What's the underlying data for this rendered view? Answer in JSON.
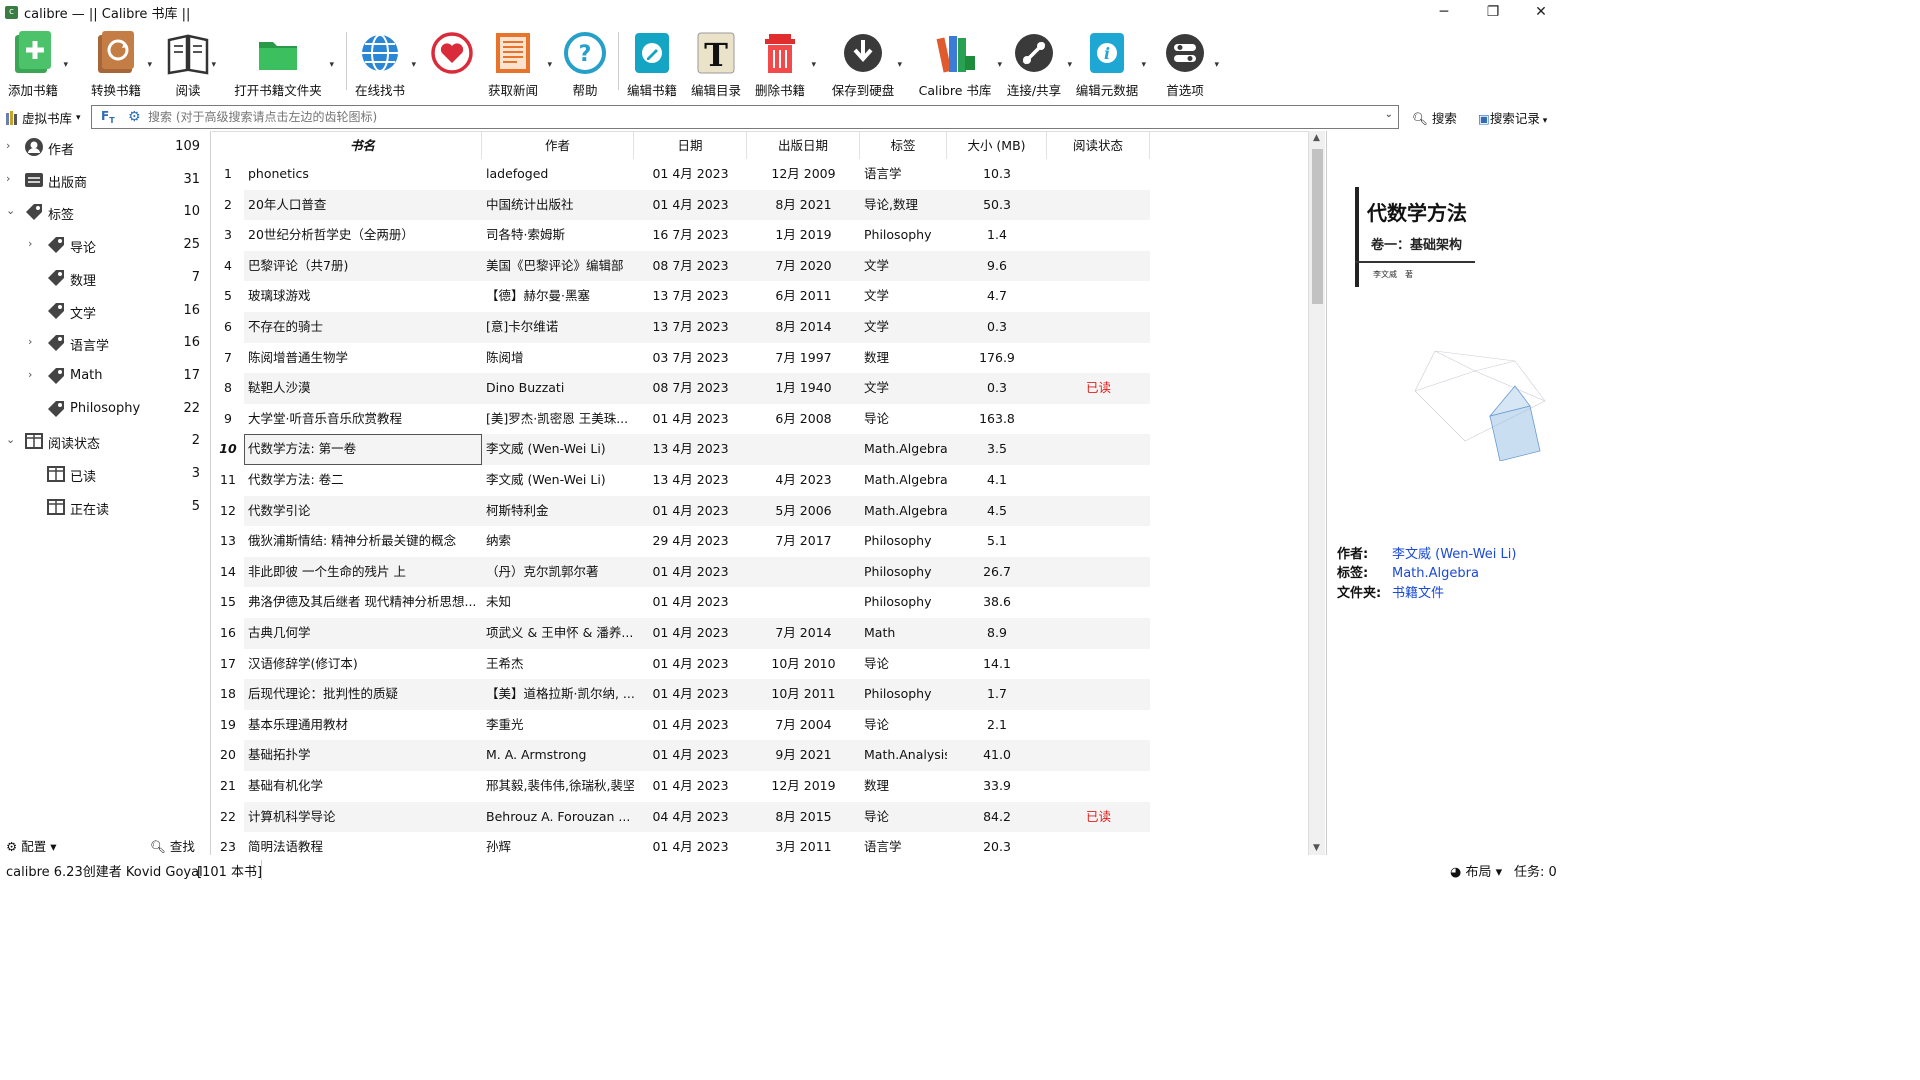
{
  "window": {
    "title": "calibre — || Calibre 书库 ||",
    "minimize": "─",
    "maximize": "❐",
    "close": "✕"
  },
  "toolbar": [
    {
      "label": "添加书籍",
      "icon": "add-book-icon",
      "dropdown": true
    },
    {
      "label": "转换书籍",
      "icon": "convert-book-icon",
      "dropdown": true
    },
    {
      "label": "阅读",
      "icon": "read-book-icon",
      "dropdown": true
    },
    {
      "label": "打开书籍文件夹",
      "icon": "open-folder-icon",
      "dropdown": true
    },
    {
      "label": "在线找书",
      "icon": "globe-icon",
      "dropdown": true
    },
    {
      "label": "",
      "icon": "heart-icon",
      "dropdown": false
    },
    {
      "label": "获取新闻",
      "icon": "news-icon",
      "dropdown": true
    },
    {
      "label": "帮助",
      "icon": "help-icon",
      "dropdown": false
    },
    {
      "label": "编辑书籍",
      "icon": "edit-book-icon",
      "dropdown": false
    },
    {
      "label": "编辑目录",
      "icon": "edit-toc-icon",
      "dropdown": false
    },
    {
      "label": "删除书籍",
      "icon": "trash-icon",
      "dropdown": true
    },
    {
      "label": "保存到硬盘",
      "icon": "save-disk-icon",
      "dropdown": true
    },
    {
      "label": "Calibre 书库",
      "icon": "library-icon",
      "dropdown": true
    },
    {
      "label": "连接/共享",
      "icon": "connect-share-icon",
      "dropdown": true
    },
    {
      "label": "编辑元数据",
      "icon": "edit-metadata-icon",
      "dropdown": true
    },
    {
      "label": "首选项",
      "icon": "preferences-icon",
      "dropdown": true
    }
  ],
  "search": {
    "virtual_library": "虚拟书库",
    "ft": "F",
    "placeholder": "搜索 (对于高级搜索请点击左边的齿轮图标)",
    "search_button": "搜索",
    "history_button": "搜索记录"
  },
  "sidebar": {
    "items": [
      {
        "label": "作者",
        "count": "109",
        "level": 0,
        "expand": "›",
        "icon": "author-icon"
      },
      {
        "label": "出版商",
        "count": "31",
        "level": 0,
        "expand": "›",
        "icon": "publisher-icon"
      },
      {
        "label": "标签",
        "count": "10",
        "level": 0,
        "expand": "⌄",
        "icon": "tag-icon"
      },
      {
        "label": "导论",
        "count": "25",
        "level": 1,
        "expand": "›",
        "icon": "tag-icon"
      },
      {
        "label": "数理",
        "count": "7",
        "level": 1,
        "expand": "",
        "icon": "tag-icon"
      },
      {
        "label": "文学",
        "count": "16",
        "level": 1,
        "expand": "",
        "icon": "tag-icon"
      },
      {
        "label": "语言学",
        "count": "16",
        "level": 1,
        "expand": "›",
        "icon": "tag-icon"
      },
      {
        "label": "Math",
        "count": "17",
        "level": 1,
        "expand": "›",
        "icon": "tag-icon"
      },
      {
        "label": "Philosophy",
        "count": "22",
        "level": 1,
        "expand": "",
        "icon": "tag-icon"
      },
      {
        "label": "阅读状态",
        "count": "2",
        "level": 0,
        "expand": "⌄",
        "icon": "column-icon"
      },
      {
        "label": "已读",
        "count": "3",
        "level": 1,
        "expand": "",
        "icon": "column-icon"
      },
      {
        "label": "正在读",
        "count": "5",
        "level": 1,
        "expand": "",
        "icon": "column-icon"
      }
    ],
    "configure": "配置",
    "find": "查找"
  },
  "table": {
    "columns": [
      "书名",
      "作者",
      "日期",
      "出版日期",
      "标签",
      "大小 (MB)",
      "阅读状态"
    ],
    "rows": [
      {
        "n": "1",
        "title": "phonetics",
        "author": "ladefoged",
        "date": "01 4月 2023",
        "pub": "12月 2009",
        "tags": "语言学",
        "size": "10.3",
        "status": ""
      },
      {
        "n": "2",
        "title": "20年人口普查",
        "author": "中国统计出版社",
        "date": "01 4月 2023",
        "pub": "8月 2021",
        "tags": "导论,数理",
        "size": "50.3",
        "status": ""
      },
      {
        "n": "3",
        "title": "20世纪分析哲学史（全两册）",
        "author": "司各特·索姆斯",
        "date": "16 7月 2023",
        "pub": "1月 2019",
        "tags": "Philosophy",
        "size": "1.4",
        "status": ""
      },
      {
        "n": "4",
        "title": "巴黎评论（共7册)",
        "author": "美国《巴黎评论》编辑部",
        "date": "08 7月 2023",
        "pub": "7月 2020",
        "tags": "文学",
        "size": "9.6",
        "status": ""
      },
      {
        "n": "5",
        "title": "玻璃球游戏",
        "author": "【德】赫尔曼·黑塞",
        "date": "13 7月 2023",
        "pub": "6月 2011",
        "tags": "文学",
        "size": "4.7",
        "status": ""
      },
      {
        "n": "6",
        "title": "不存在的骑士",
        "author": "[意]卡尔维诺",
        "date": "13 7月 2023",
        "pub": "8月 2014",
        "tags": "文学",
        "size": "0.3",
        "status": ""
      },
      {
        "n": "7",
        "title": "陈阅增普通生物学",
        "author": "陈阅增",
        "date": "03 7月 2023",
        "pub": "7月 1997",
        "tags": "数理",
        "size": "176.9",
        "status": ""
      },
      {
        "n": "8",
        "title": "鞑靼人沙漠",
        "author": "Dino Buzzati",
        "date": "08 7月 2023",
        "pub": "1月 1940",
        "tags": "文学",
        "size": "0.3",
        "status": "已读"
      },
      {
        "n": "9",
        "title": "大学堂·听音乐音乐欣赏教程",
        "author": "[美]罗杰·凯密恩 王美珠...",
        "date": "01 4月 2023",
        "pub": "6月 2008",
        "tags": "导论",
        "size": "163.8",
        "status": ""
      },
      {
        "n": "10",
        "title": "代数学方法: 第一卷",
        "author": "李文威 (Wen-Wei Li)",
        "date": "13 4月 2023",
        "pub": "",
        "tags": "Math.Algebra",
        "size": "3.5",
        "status": ""
      },
      {
        "n": "11",
        "title": "代数学方法: 卷二",
        "author": "李文威 (Wen-Wei Li)",
        "date": "13 4月 2023",
        "pub": "4月 2023",
        "tags": "Math.Algebra",
        "size": "4.1",
        "status": ""
      },
      {
        "n": "12",
        "title": "代数学引论",
        "author": "柯斯特利金",
        "date": "01 4月 2023",
        "pub": "5月 2006",
        "tags": "Math.Algebra",
        "size": "4.5",
        "status": ""
      },
      {
        "n": "13",
        "title": "俄狄浦斯情结: 精神分析最关键的概念",
        "author": "纳索",
        "date": "29 4月 2023",
        "pub": "7月 2017",
        "tags": "Philosophy",
        "size": "5.1",
        "status": ""
      },
      {
        "n": "14",
        "title": "非此即彼 一个生命的残片 上",
        "author": "（丹）克尔凯郭尔著",
        "date": "01 4月 2023",
        "pub": "",
        "tags": "Philosophy",
        "size": "26.7",
        "status": ""
      },
      {
        "n": "15",
        "title": "弗洛伊德及其后继者 现代精神分析思想...",
        "author": "未知",
        "date": "01 4月 2023",
        "pub": "",
        "tags": "Philosophy",
        "size": "38.6",
        "status": ""
      },
      {
        "n": "16",
        "title": "古典几何学",
        "author": "项武义 & 王申怀 & 潘养...",
        "date": "01 4月 2023",
        "pub": "7月 2014",
        "tags": "Math",
        "size": "8.9",
        "status": ""
      },
      {
        "n": "17",
        "title": "汉语修辞学(修订本)",
        "author": "王希杰",
        "date": "01 4月 2023",
        "pub": "10月 2010",
        "tags": "导论",
        "size": "14.1",
        "status": ""
      },
      {
        "n": "18",
        "title": "后现代理论：批判性的质疑",
        "author": "【美】道格拉斯·凯尔纳, ...",
        "date": "01 4月 2023",
        "pub": "10月 2011",
        "tags": "Philosophy",
        "size": "1.7",
        "status": ""
      },
      {
        "n": "19",
        "title": "基本乐理通用教材",
        "author": "李重光",
        "date": "01 4月 2023",
        "pub": "7月 2004",
        "tags": "导论",
        "size": "2.1",
        "status": ""
      },
      {
        "n": "20",
        "title": "基础拓扑学",
        "author": "M. A. Armstrong",
        "date": "01 4月 2023",
        "pub": "9月 2021",
        "tags": "Math.Analysis",
        "size": "41.0",
        "status": ""
      },
      {
        "n": "21",
        "title": "基础有机化学",
        "author": "邢其毅,裴伟伟,徐瑞秋,裴坚",
        "date": "01 4月 2023",
        "pub": "12月 2019",
        "tags": "数理",
        "size": "33.9",
        "status": ""
      },
      {
        "n": "22",
        "title": "计算机科学导论",
        "author": "Behrouz A. Forouzan ...",
        "date": "04 4月 2023",
        "pub": "8月 2015",
        "tags": "导论",
        "size": "84.2",
        "status": "已读"
      },
      {
        "n": "23",
        "title": "简明法语教程",
        "author": "孙辉",
        "date": "01 4月 2023",
        "pub": "3月 2011",
        "tags": "语言学",
        "size": "20.3",
        "status": ""
      }
    ]
  },
  "details": {
    "cover_title": "代数学方法",
    "cover_subtitle": "卷一：基础架构",
    "cover_author": "李文威　著",
    "author_key": "作者:",
    "author_val": "李文威 (Wen-Wei Li)",
    "tags_key": "标签:",
    "tags_val": "Math.Algebra",
    "folder_key": "文件夹:",
    "folder_val": "书籍文件"
  },
  "status": {
    "left": "calibre 6.23创建者 Kovid Goyal",
    "count": "[101 本书]",
    "layout": "布局",
    "jobs": "任务:  0"
  },
  "colors": {
    "read_status": "#e0201c",
    "link": "#1a4ad6"
  }
}
